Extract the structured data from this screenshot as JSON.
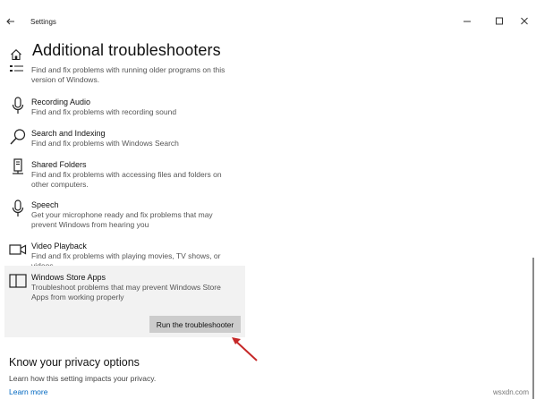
{
  "window": {
    "title": "Settings",
    "back_icon": "back-arrow-icon",
    "controls": [
      "minimize-icon",
      "maximize-icon",
      "close-icon"
    ]
  },
  "page": {
    "title": "Additional troubleshooters",
    "home_icon": "home-icon"
  },
  "partial_item": {
    "icon": "compatibility-icon",
    "description": "Find and fix problems with running older programs on this version of Windows."
  },
  "troubleshooters": [
    {
      "title": "Recording Audio",
      "description": "Find and fix problems with recording sound",
      "icon": "microphone-icon"
    },
    {
      "title": "Search and Indexing",
      "description": "Find and fix problems with Windows Search",
      "icon": "search-icon"
    },
    {
      "title": "Shared Folders",
      "description": "Find and fix problems with accessing files and folders on other computers.",
      "icon": "shared-folder-icon"
    },
    {
      "title": "Speech",
      "description": "Get your microphone ready and fix problems that may prevent Windows from hearing you",
      "icon": "microphone-icon"
    },
    {
      "title": "Video Playback",
      "description": "Find and fix problems with playing movies, TV shows, or videos",
      "icon": "video-camera-icon"
    },
    {
      "title": "Windows Store Apps",
      "description": "Troubleshoot problems that may prevent Windows Store Apps from working properly",
      "icon": "store-apps-icon",
      "selected": true
    }
  ],
  "run_button": {
    "label": "Run the troubleshooter"
  },
  "privacy": {
    "heading": "Know your privacy options",
    "description": "Learn how this setting impacts your privacy.",
    "link": "Learn more"
  },
  "watermark": "wsxdn.com",
  "colors": {
    "accent": "#0067c0",
    "arrow": "#c62828",
    "selected_bg": "#f2f2f2",
    "button_bg": "#cccccc"
  }
}
